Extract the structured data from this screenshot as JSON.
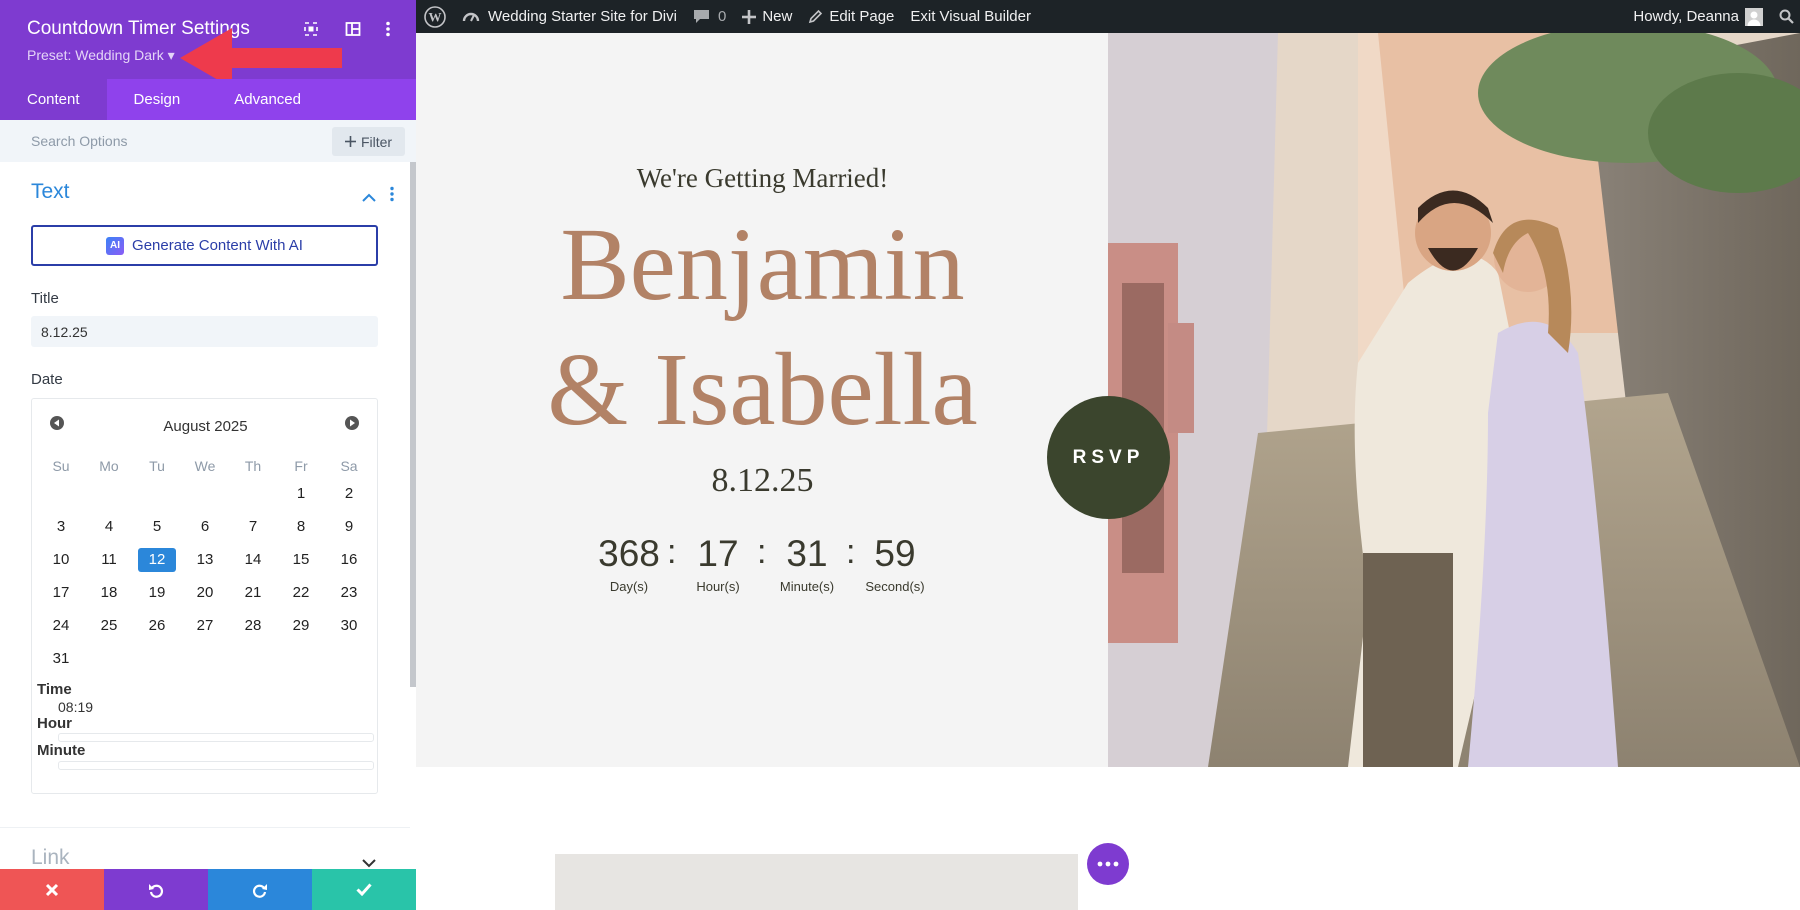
{
  "admin_bar": {
    "site_name": "Wedding Starter Site for Divi",
    "comments_count": "0",
    "new_label": "New",
    "edit_page_label": "Edit Page",
    "exit_builder_label": "Exit Visual Builder",
    "howdy_text": "Howdy, Deanna"
  },
  "panel": {
    "title": "Countdown Timer Settings",
    "preset": "Preset: Wedding Dark ▾",
    "tabs": [
      {
        "label": "Content",
        "active": true
      },
      {
        "label": "Design",
        "active": false
      },
      {
        "label": "Advanced",
        "active": false
      }
    ],
    "search_placeholder": "Search Options",
    "filter_label": "Filter",
    "section_text": "Text",
    "ai_button_label": "Generate Content With AI",
    "ai_badge": "AI",
    "title_label": "Title",
    "title_value": "8.12.25",
    "date_label": "Date",
    "calendar": {
      "month": "August 2025",
      "weekdays": [
        "Su",
        "Mo",
        "Tu",
        "We",
        "Th",
        "Fr",
        "Sa"
      ],
      "weeks": [
        [
          "",
          "",
          "",
          "",
          "",
          "1",
          "2"
        ],
        [
          "3",
          "4",
          "5",
          "6",
          "7",
          "8",
          "9"
        ],
        [
          "10",
          "11",
          "12",
          "13",
          "14",
          "15",
          "16"
        ],
        [
          "17",
          "18",
          "19",
          "20",
          "21",
          "22",
          "23"
        ],
        [
          "24",
          "25",
          "26",
          "27",
          "28",
          "29",
          "30"
        ],
        [
          "31",
          "",
          "",
          "",
          "",
          "",
          ""
        ]
      ],
      "selected_day": "12"
    },
    "time_label": "Time",
    "time_value": "08:19",
    "hour_label": "Hour",
    "minute_label": "Minute",
    "section_link": "Link"
  },
  "page": {
    "tagline": "We're Getting Married!",
    "name_line1": "Benjamin",
    "name_line2": "& Isabella",
    "date": "8.12.25",
    "countdown": [
      {
        "value": "368",
        "label": "Day(s)"
      },
      {
        "value": "17",
        "label": "Hour(s)"
      },
      {
        "value": "31",
        "label": "Minute(s)"
      },
      {
        "value": "59",
        "label": "Second(s)"
      }
    ],
    "separator": ":",
    "rsvp_label": "RSVP"
  },
  "colors": {
    "panel_header": "#7e3bd0",
    "panel_tabs": "#8f42ec",
    "accent_blue": "#2b87da",
    "name_color": "#b28266",
    "rsvp_bg": "#3b452d",
    "footer_cancel": "#ef5555",
    "footer_undo": "#7e3bd0",
    "footer_redo": "#2b87da",
    "footer_save": "#29c4a9",
    "annotation_arrow": "#ee3a4c"
  }
}
